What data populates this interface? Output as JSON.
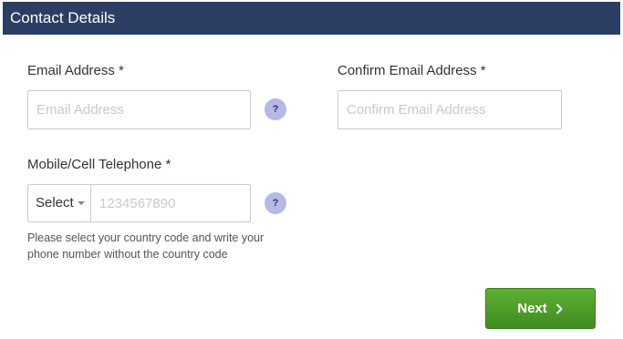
{
  "header": {
    "title": "Contact Details"
  },
  "email": {
    "label": "Email Address *",
    "placeholder": "Email Address",
    "help": "?"
  },
  "confirm_email": {
    "label": "Confirm Email Address *",
    "placeholder": "Confirm Email Address"
  },
  "phone": {
    "label": "Mobile/Cell Telephone *",
    "country_select": "Select",
    "placeholder": "1234567890",
    "help": "?",
    "hint": "Please select your country code and write your phone number without the country code"
  },
  "actions": {
    "next_label": "Next"
  },
  "colors": {
    "header_bg": "#2c3e63",
    "next_button": "#4e9e2a",
    "help_badge": "#b6b9e6"
  },
  "icons": {
    "next": "chevron-right-icon",
    "select": "caret-down-icon"
  }
}
